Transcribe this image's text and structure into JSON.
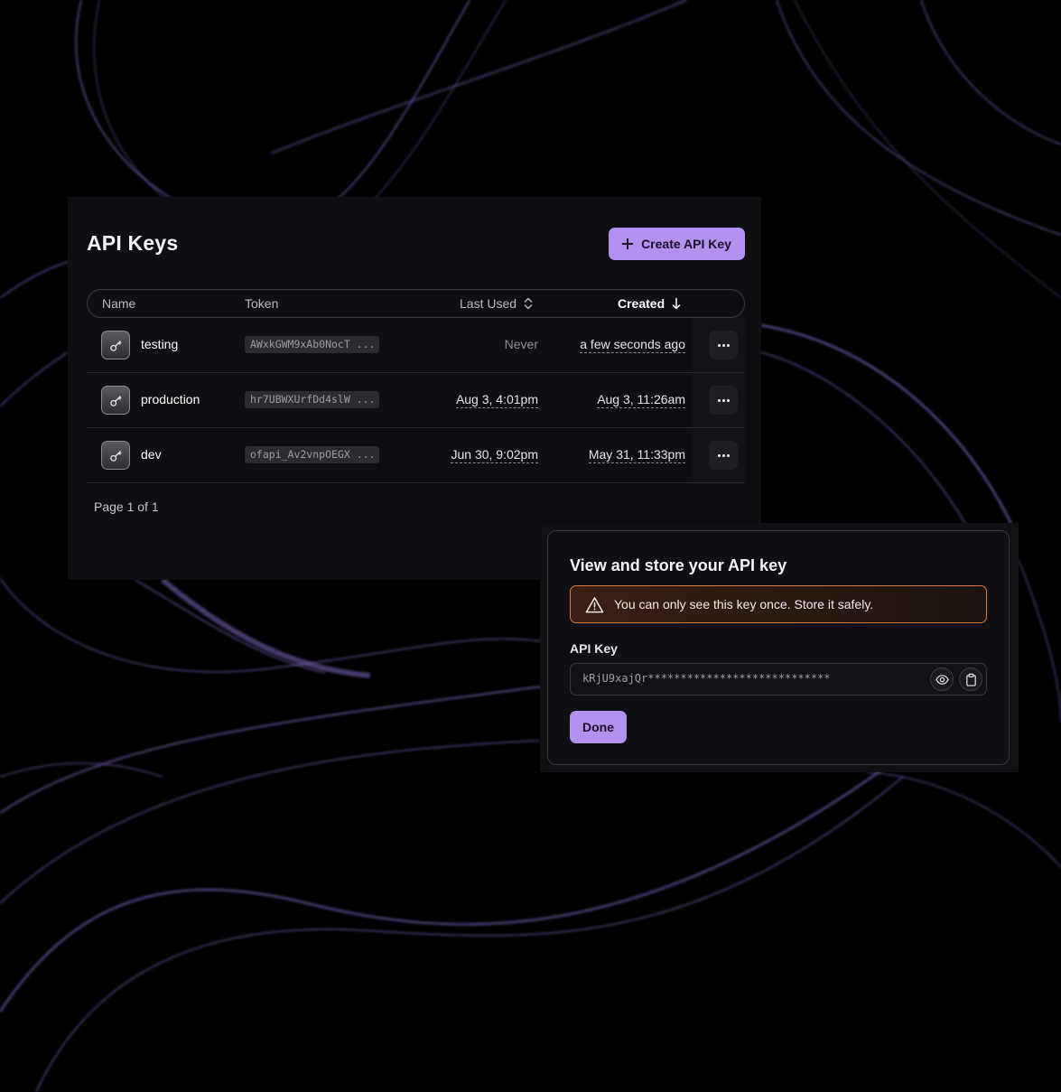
{
  "panel": {
    "title": "API Keys",
    "create_button": "Create API Key",
    "columns": {
      "name": "Name",
      "token": "Token",
      "last_used": "Last Used",
      "created": "Created"
    },
    "rows": [
      {
        "name": "testing",
        "token": "AWxkGWM9xAb0NocT ...",
        "last_used": "Never",
        "created": "a few seconds ago"
      },
      {
        "name": "production",
        "token": "hr7UBWXUrfDd4slW ...",
        "last_used": "Aug 3, 4:01pm",
        "created": "Aug 3, 11:26am"
      },
      {
        "name": "dev",
        "token": "ofapi_Av2vnpOEGX ...",
        "last_used": "Jun 30, 9:02pm",
        "created": "May 31, 11:33pm"
      }
    ],
    "pagination": "Page 1 of 1"
  },
  "dialog": {
    "title": "View and store your API key",
    "warning": "You can only see this key once. Store it safely.",
    "field_label": "API Key",
    "key_value": "kRjU9xajQr****************************",
    "done_button": "Done"
  },
  "icons": {
    "row_icon": "key-icon",
    "row_menu": "more-horizontal-icon",
    "warning": "warning-triangle-icon",
    "reveal": "eye-icon",
    "copy": "clipboard-icon",
    "create": "plus-icon",
    "sort_last_used": "chevron-up-down-icon",
    "sort_created": "arrow-down-icon"
  },
  "colors": {
    "accent": "#b291f0",
    "background": "#000000",
    "panel": "#0e0f12",
    "warning_border": "#d97a3c",
    "swirl": "#8b6fd6"
  }
}
